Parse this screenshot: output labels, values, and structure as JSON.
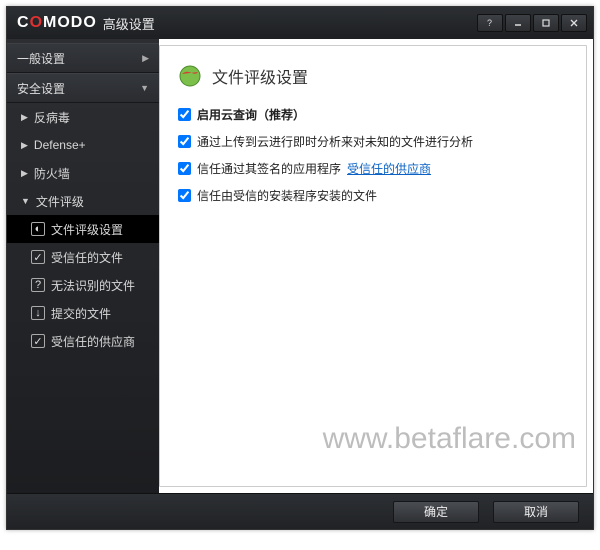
{
  "window": {
    "brand_prefix": "C",
    "brand_rest": "MODO",
    "title": "高级设置"
  },
  "sidebar": {
    "sections": [
      {
        "label": "一般设置",
        "expanded": false
      },
      {
        "label": "安全设置",
        "expanded": true
      }
    ],
    "items": [
      {
        "label": "反病毒"
      },
      {
        "label": "Defense+"
      },
      {
        "label": "防火墙"
      },
      {
        "label": "文件评级"
      }
    ],
    "subs": [
      {
        "label": "文件评级设置",
        "icon": "◐",
        "active": true
      },
      {
        "label": "受信任的文件",
        "icon": "✓"
      },
      {
        "label": "无法识别的文件",
        "icon": "?"
      },
      {
        "label": "提交的文件",
        "icon": "↓"
      },
      {
        "label": "受信任的供应商",
        "icon": "✓"
      }
    ]
  },
  "page": {
    "title": "文件评级设置",
    "options": [
      {
        "label": "启用云查询（推荐）",
        "bold": true,
        "checked": true
      },
      {
        "label": "通过上传到云进行即时分析来对未知的文件进行分析",
        "checked": true
      },
      {
        "label": "信任通过其签名的应用程序",
        "checked": true,
        "link": "受信任的供应商"
      },
      {
        "label": "信任由受信的安装程序安装的文件",
        "checked": true
      }
    ]
  },
  "footer": {
    "ok": "确定",
    "cancel": "取消"
  },
  "watermark": "www.betaflare.com"
}
